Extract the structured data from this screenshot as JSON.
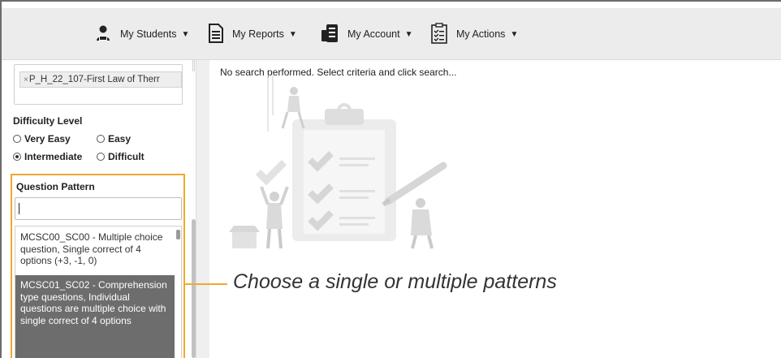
{
  "nav": {
    "students": "My Students",
    "reports": "My Reports",
    "account": "My Account",
    "actions": "My Actions",
    "caret": "▼"
  },
  "sidebar": {
    "chip": "P_H_22_107-First Law of Therr",
    "chip_remove": "×",
    "difficulty": {
      "label": "Difficulty Level",
      "options": [
        "Very Easy",
        "Easy",
        "Intermediate",
        "Difficult"
      ],
      "selected": "Intermediate"
    },
    "question_pattern": {
      "label": "Question Pattern",
      "search_value": "",
      "options": [
        "MCSC00_SC00 - Multiple choice question, Single correct of 4 options (+3, -1, 0)",
        "MCSC01_SC02 - Comprehension type questions, Individual questions are multiple choice with single correct of 4 options"
      ],
      "highlighted_index": 1
    }
  },
  "main": {
    "status": "No search performed. Select criteria and click search..."
  },
  "annotation": {
    "callout": "Choose a single or multiple patterns",
    "color": "#f0a830"
  },
  "colors": {
    "nav_bg": "#ececec",
    "highlight_bg": "#6d6d6d",
    "accent": "#f0a830"
  }
}
